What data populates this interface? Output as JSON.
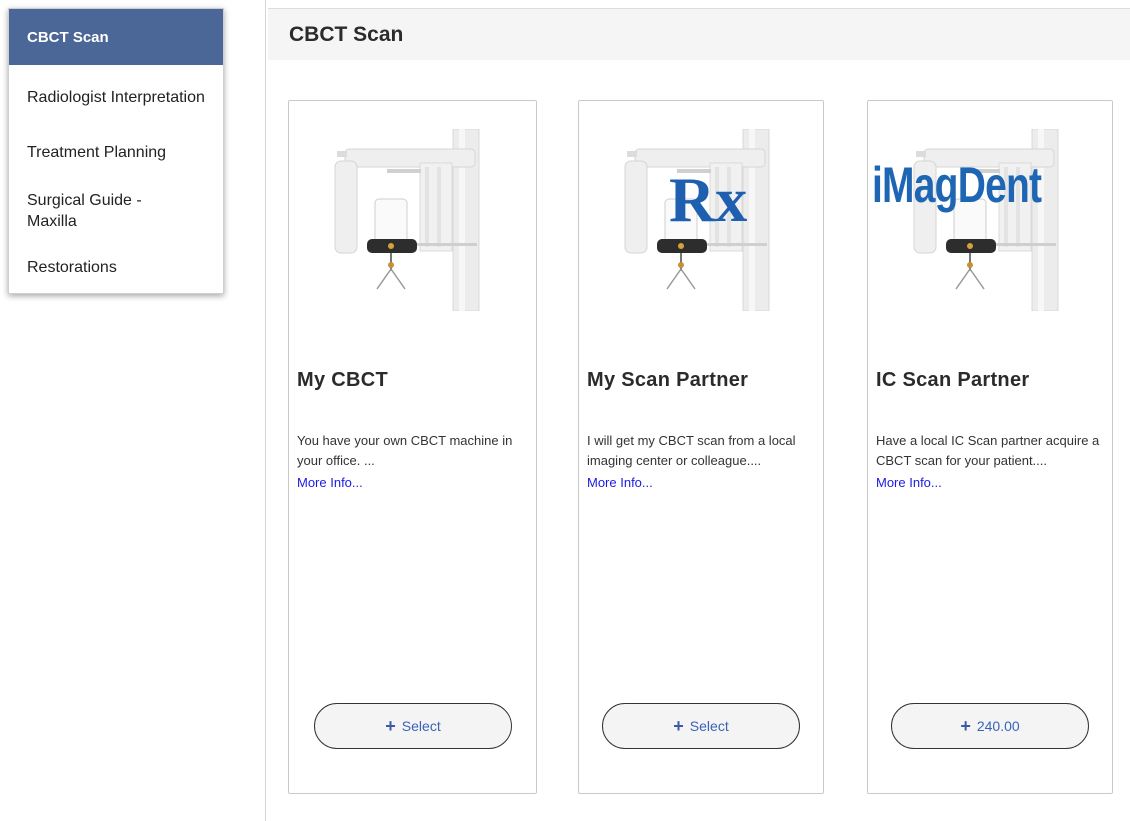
{
  "sidebar": {
    "items": [
      {
        "label": "CBCT Scan",
        "active": true
      },
      {
        "label": "Radiologist Interpretation"
      },
      {
        "label": "Treatment Planning"
      },
      {
        "label": "Surgical Guide - Maxilla"
      },
      {
        "label": "Restorations"
      }
    ]
  },
  "header": {
    "title": "CBCT Scan"
  },
  "cards": [
    {
      "title": "My CBCT",
      "description": "You have your own CBCT machine in your office. ...",
      "more_link": "More Info...",
      "button_label": "Select",
      "image_icon": "cbct-machine-icon"
    },
    {
      "title": "My Scan Partner",
      "description": "I will get my CBCT scan from a local imaging center or colleague....",
      "more_link": "More Info...",
      "button_label": "Select",
      "image_icon": "cbct-machine-rx-icon",
      "overlay_text": "Rx"
    },
    {
      "title": "IC Scan Partner",
      "description": "Have a local IC Scan partner acquire a CBCT scan for your patient....",
      "more_link": "More Info...",
      "button_label": "240.00",
      "image_icon": "cbct-machine-imagdent-icon",
      "overlay_text": "iMagDent"
    }
  ],
  "colors": {
    "sidebar_active_bg": "#4a6797",
    "link": "#1a1ae6",
    "button_text": "#3a63b8",
    "logo_blue": "#1e66b3"
  }
}
